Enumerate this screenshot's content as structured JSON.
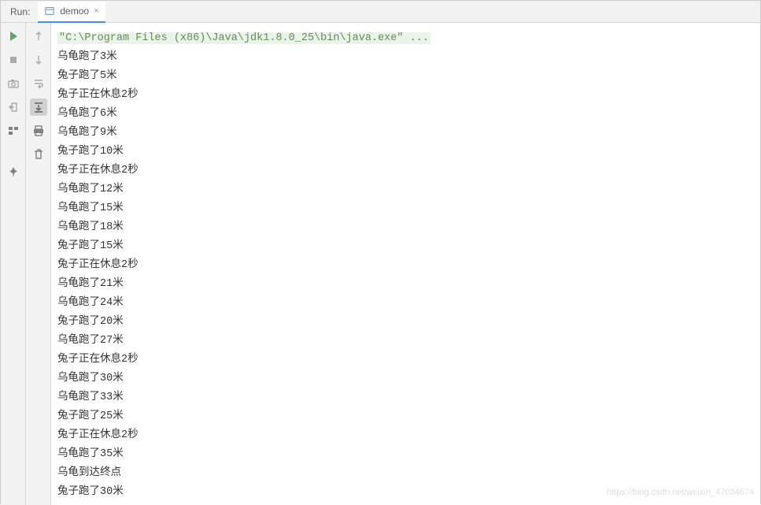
{
  "header": {
    "run_label": "Run:",
    "tab_name": "demoo",
    "tab_close": "×"
  },
  "console": {
    "command": "\"C:\\Program Files (x86)\\Java\\jdk1.8.0_25\\bin\\java.exe\" ...",
    "lines": [
      "乌龟跑了3米",
      "兔子跑了5米",
      "兔子正在休息2秒",
      "乌龟跑了6米",
      "乌龟跑了9米",
      "兔子跑了10米",
      "兔子正在休息2秒",
      "乌龟跑了12米",
      "乌龟跑了15米",
      "乌龟跑了18米",
      "兔子跑了15米",
      "兔子正在休息2秒",
      "乌龟跑了21米",
      "乌龟跑了24米",
      "兔子跑了20米",
      "乌龟跑了27米",
      "兔子正在休息2秒",
      "乌龟跑了30米",
      "乌龟跑了33米",
      "兔子跑了25米",
      "兔子正在休息2秒",
      "乌龟跑了35米",
      "乌龟到达终点",
      "兔子跑了30米"
    ]
  },
  "watermark": "https://blog.csdn.net/weixin_47034674"
}
